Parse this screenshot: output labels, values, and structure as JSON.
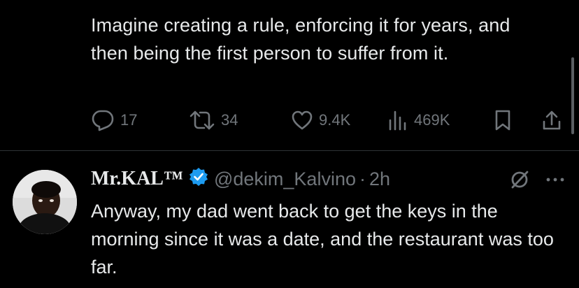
{
  "tweet": {
    "text": "Imagine creating a rule, enforcing it for years, and then being the first person to suffer from it."
  },
  "actions": {
    "replies": "17",
    "retweets": "34",
    "likes": "9.4K",
    "views": "469K"
  },
  "reply": {
    "display_name": "Mr.KAL™",
    "handle": "@dekim_Kalvino",
    "separator": "·",
    "time": "2h",
    "text": "Anyway, my dad went back to get the keys in the morning since it was a date, and the restaurant was too far."
  },
  "colors": {
    "background": "#000000",
    "text": "#e7e9ea",
    "muted": "#71767b",
    "verified": "#1d9bf0",
    "divider": "#2f3336"
  },
  "icons": [
    "reply-icon",
    "retweet-icon",
    "like-icon",
    "views-icon",
    "bookmark-icon",
    "share-icon",
    "verified-badge-icon",
    "grok-icon",
    "more-icon"
  ]
}
